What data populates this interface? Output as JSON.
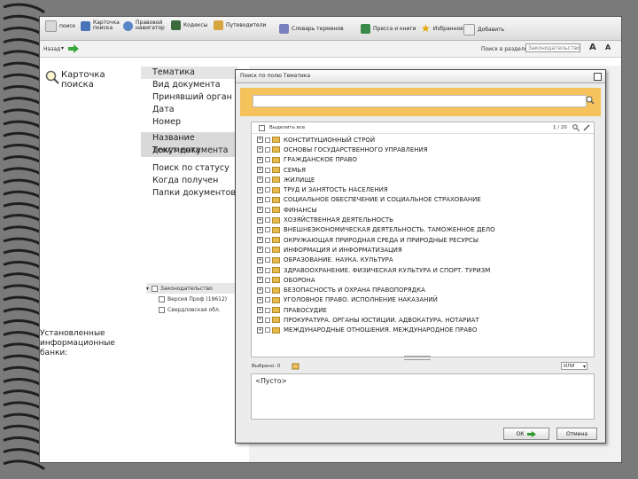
{
  "toolbar": {
    "items": [
      {
        "label": "поиск",
        "icon": "doc-icon"
      },
      {
        "label": "Карточка поиска",
        "icon": "search-card-icon"
      },
      {
        "label": "Правовой навигатор",
        "icon": "navigator-icon"
      },
      {
        "label": "Кодексы",
        "icon": "codex-icon"
      },
      {
        "label": "Путеводители",
        "icon": "guide-icon"
      },
      {
        "label": "Словарь терминов",
        "icon": "dictionary-icon"
      },
      {
        "label": "Пресса и книги",
        "icon": "press-icon"
      },
      {
        "label": "Избранное",
        "icon": "star-icon"
      },
      {
        "label": "Добавить",
        "icon": "add-icon"
      }
    ]
  },
  "nav": {
    "back_label": "Назад",
    "section_label": "Поиск в разделе:",
    "section_value": "Законодательство"
  },
  "sidebar": {
    "card_title": "Карточка поиска",
    "menu": [
      "Тематика",
      "Вид документа",
      "Принявший орган",
      "Дата",
      "Номер",
      "Название документа",
      "Текст документа",
      "Поиск по статусу",
      "Когда получен",
      "Папки документов"
    ],
    "banks_label": "Установленные информационные банки:",
    "banks": [
      {
        "label": "Законодательство",
        "checked": true
      },
      {
        "label": "Версия Проф (19612)",
        "checked": true
      },
      {
        "label": "Свердловская обл.",
        "checked": true
      }
    ]
  },
  "dialog": {
    "title": "Поиск по полю Тематика",
    "select_all": "Выделить все",
    "count": "1 / 20",
    "categories": [
      "КОНСТИТУЦИОННЫЙ СТРОЙ",
      "ОСНОВЫ ГОСУДАРСТВЕННОГО УПРАВЛЕНИЯ",
      "ГРАЖДАНСКОЕ ПРАВО",
      "СЕМЬЯ",
      "ЖИЛИЩЕ",
      "ТРУД И ЗАНЯТОСТЬ НАСЕЛЕНИЯ",
      "СОЦИАЛЬНОЕ ОБЕСПЕЧЕНИЕ И СОЦИАЛЬНОЕ СТРАХОВАНИЕ",
      "ФИНАНСЫ",
      "ХОЗЯЙСТВЕННАЯ ДЕЯТЕЛЬНОСТЬ",
      "ВНЕШНЕЭКОНОМИЧЕСКАЯ ДЕЯТЕЛЬНОСТЬ. ТАМОЖЕННОЕ ДЕЛО",
      "ОКРУЖАЮЩАЯ ПРИРОДНАЯ СРЕДА И ПРИРОДНЫЕ РЕСУРСЫ",
      "ИНФОРМАЦИЯ И ИНФОРМАТИЗАЦИЯ",
      "ОБРАЗОВАНИЕ. НАУКА. КУЛЬТУРА",
      "ЗДРАВООХРАНЕНИЕ. ФИЗИЧЕСКАЯ КУЛЬТУРА И СПОРТ. ТУРИЗМ",
      "ОБОРОНА",
      "БЕЗОПАСНОСТЬ И ОХРАНА ПРАВОПОРЯДКА",
      "УГОЛОВНОЕ ПРАВО. ИСПОЛНЕНИЕ НАКАЗАНИЙ",
      "ПРАВОСУДИЕ",
      "ПРОКУРАТУРА. ОРГАНЫ ЮСТИЦИИ. АДВОКАТУРА. НОТАРИАТ",
      "МЕЖДУНАРОДНЫЕ ОТНОШЕНИЯ. МЕЖДУНАРОДНОЕ ПРАВО"
    ],
    "selected_label": "Выбрано: 0",
    "logic_value": "ИЛИ",
    "empty_text": "<Пусто>",
    "ok_label": "ОК",
    "cancel_label": "Отмена"
  },
  "colors": {
    "banner": "#f6c25c",
    "frame_bg": "#7a7a7a",
    "ok_arrow": "#2e9a2e"
  }
}
